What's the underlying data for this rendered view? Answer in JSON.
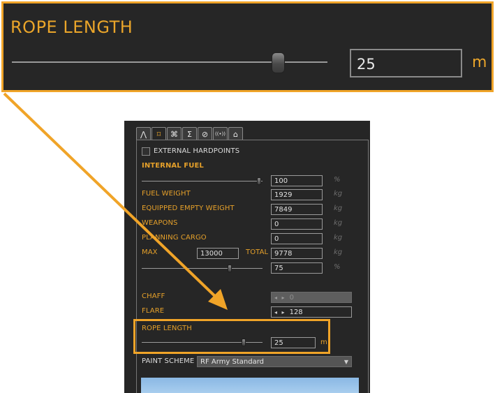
{
  "zoom": {
    "title": "ROPE LENGTH",
    "value": "25",
    "unit": "m",
    "slider_level": 0.84
  },
  "tabs": [
    {
      "icon": "route-icon",
      "glyph": "⋀"
    },
    {
      "icon": "crosshair-icon",
      "glyph": "⌑",
      "active": true
    },
    {
      "icon": "command-icon",
      "glyph": "⌘"
    },
    {
      "icon": "sigma-icon",
      "glyph": "Σ"
    },
    {
      "icon": "prohibit-icon",
      "glyph": "⊘"
    },
    {
      "icon": "radio-icon",
      "glyph": "((•))"
    },
    {
      "icon": "hangar-icon",
      "glyph": "⌂"
    }
  ],
  "external_hardpoints": {
    "label": "EXTERNAL HARDPOINTS",
    "checked": false
  },
  "internal_fuel": {
    "label": "INTERNAL FUEL",
    "value": "100",
    "unit": "%",
    "slider_level": 1.0
  },
  "rows": [
    {
      "label": "FUEL WEIGHT",
      "value": "1929",
      "unit": "kg"
    },
    {
      "label": "EQUIPPED EMPTY WEIGHT",
      "value": "7849",
      "unit": "kg"
    },
    {
      "label": "WEAPONS",
      "value": "0",
      "unit": "kg"
    },
    {
      "label": "PLANNING CARGO",
      "value": "0",
      "unit": "kg"
    }
  ],
  "totals": {
    "max_label": "MAX",
    "max_value": "13000",
    "total_label": "TOTAL",
    "total_value": "9778",
    "unit": "kg"
  },
  "load_percent": {
    "value": "75",
    "unit": "%",
    "slider_level": 0.75
  },
  "chaff": {
    "label": "CHAFF",
    "spin": "◂ ▸",
    "value": "0"
  },
  "flare": {
    "label": "FLARE",
    "spin": "◂ ▸",
    "value": "128"
  },
  "rope": {
    "label": "ROPE LENGTH",
    "value": "25",
    "unit": "m",
    "slider_level": 0.84
  },
  "paint": {
    "label": "PAINT SCHEME",
    "value": "RF Army Standard"
  },
  "colors": {
    "accent": "#f0a428",
    "label": "#e5a02a",
    "panel": "#262626"
  }
}
